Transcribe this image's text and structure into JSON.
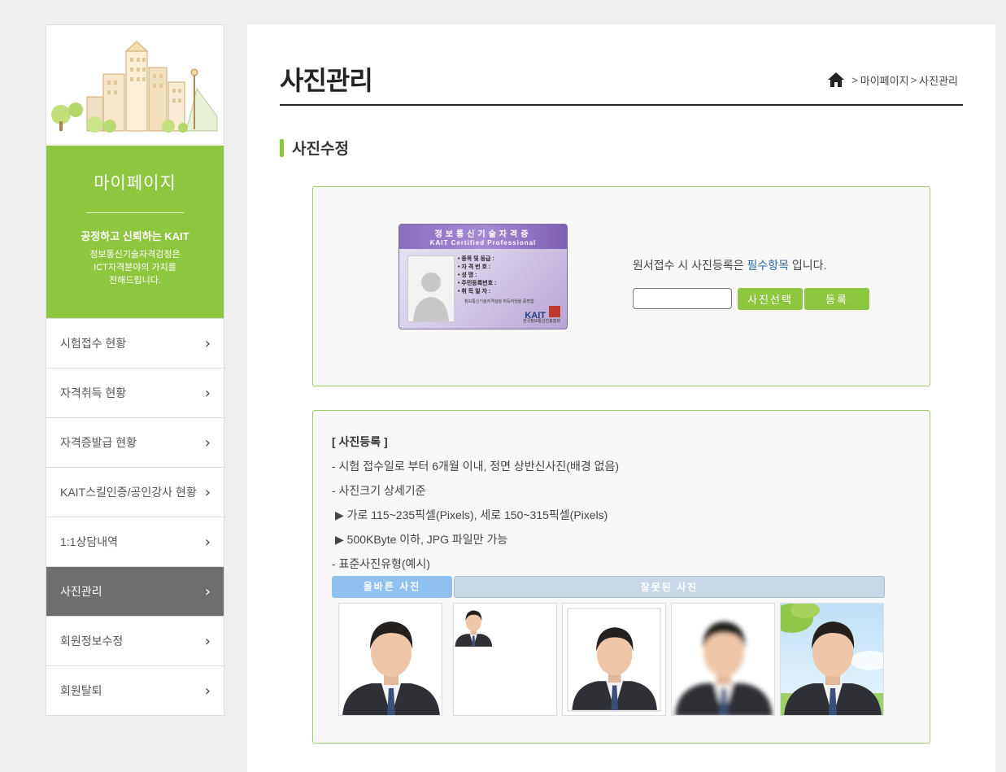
{
  "sidebar": {
    "hero": {
      "title": "마이페이지",
      "slogan": "공정하고 신뢰하는 KAIT",
      "desc_line1": "정보통신기술자격검정은",
      "desc_line2": "ICT자격분야의 가치를",
      "desc_line3": "전해드립니다."
    },
    "items": [
      {
        "label": "시험접수 현황"
      },
      {
        "label": "자격취득 현황"
      },
      {
        "label": "자격증발급 현황"
      },
      {
        "label": "KAIT스킬인증/공인강사 현황"
      },
      {
        "label": "1:1상담내역"
      },
      {
        "label": "사진관리"
      },
      {
        "label": "회원정보수정"
      },
      {
        "label": "회원탈퇴"
      }
    ],
    "active_index": 5
  },
  "header": {
    "title": "사진관리",
    "breadcrumb": [
      "마이페이지",
      "사진관리"
    ]
  },
  "section": {
    "title": "사진수정"
  },
  "upload": {
    "card": {
      "title": "정보통신기술자격증",
      "subtitle": "KAIT Certified Professional",
      "fields": [
        "• 종목 및 등급 :",
        "• 자 격 번 호 :",
        "• 성       명 :",
        "• 주민등록번호 :",
        "• 취 득 일 자 :"
      ],
      "issuer": "정보통신기술자격검정 취득자임을 증명함",
      "logo": "KAIT",
      "logo_sub": "한국정보통신진흥협회"
    },
    "notice_before": "원서접수 시 사진등록은 ",
    "notice_required": "필수항목",
    "notice_after": " 입니다.",
    "select_button": "사진선택",
    "register_button": "등록"
  },
  "guide": {
    "heading": "[ 사진등록 ]",
    "lines": [
      "- 시험 접수일로 부터 6개월 이내, 정면 상반신사진(배경 없음)",
      "- 사진크기 상세기준",
      "▶ 가로 115~235픽셀(Pixels), 세로 150~315픽셀(Pixels)",
      "▶ 500KByte 이하, JPG 파일만 가능",
      "- 표준사진유형(예시)"
    ],
    "tab_correct": "올바른 사진",
    "tab_wrong": "잘못된 사진"
  },
  "colors": {
    "accent_green": "#8dc63f",
    "active_menu": "#6e6e6e",
    "link_blue": "#2a6aa3",
    "tab_correct": "#8fc0f0",
    "tab_wrong": "#c9d7e6"
  }
}
